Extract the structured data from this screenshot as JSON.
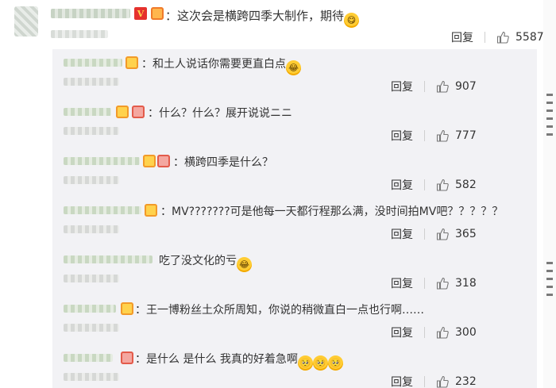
{
  "main_comment": {
    "text": "：这次会是横跨四季大制作，期待",
    "emoji": "yum-emoji",
    "verified_badge": "V",
    "reply_label": "回复",
    "likes": "5587"
  },
  "replies": [
    {
      "text": "：和土人说话你需要更直白点",
      "emoji_count": 1,
      "reply_label": "回复",
      "likes": "907"
    },
    {
      "text": "：什么？什么？展开说说ニニ",
      "emoji_count": 0,
      "reply_label": "回复",
      "likes": "777"
    },
    {
      "text": "：横跨四季是什么？",
      "emoji_count": 0,
      "reply_label": "回复",
      "likes": "582"
    },
    {
      "text": "：MV???????可是他每一天都行程那么满，没时间拍MV吧？？？？？",
      "emoji_count": 0,
      "reply_label": "回复",
      "likes": "365"
    },
    {
      "text": "吃了没文化的亏",
      "emoji_count": 1,
      "reply_label": "回复",
      "likes": "318"
    },
    {
      "text": "：王一博粉丝土众所周知，你说的稍微直白一点也行啊……",
      "emoji_count": 0,
      "reply_label": "回复",
      "likes": "300"
    },
    {
      "text": "：是什么 是什么 我真的好着急啊",
      "emoji_count": 3,
      "reply_label": "回复",
      "likes": "232"
    }
  ],
  "colors": {
    "reply_bg": "#f2f2f5",
    "emoji": "#ffcc33",
    "verified": "#e5322d"
  }
}
